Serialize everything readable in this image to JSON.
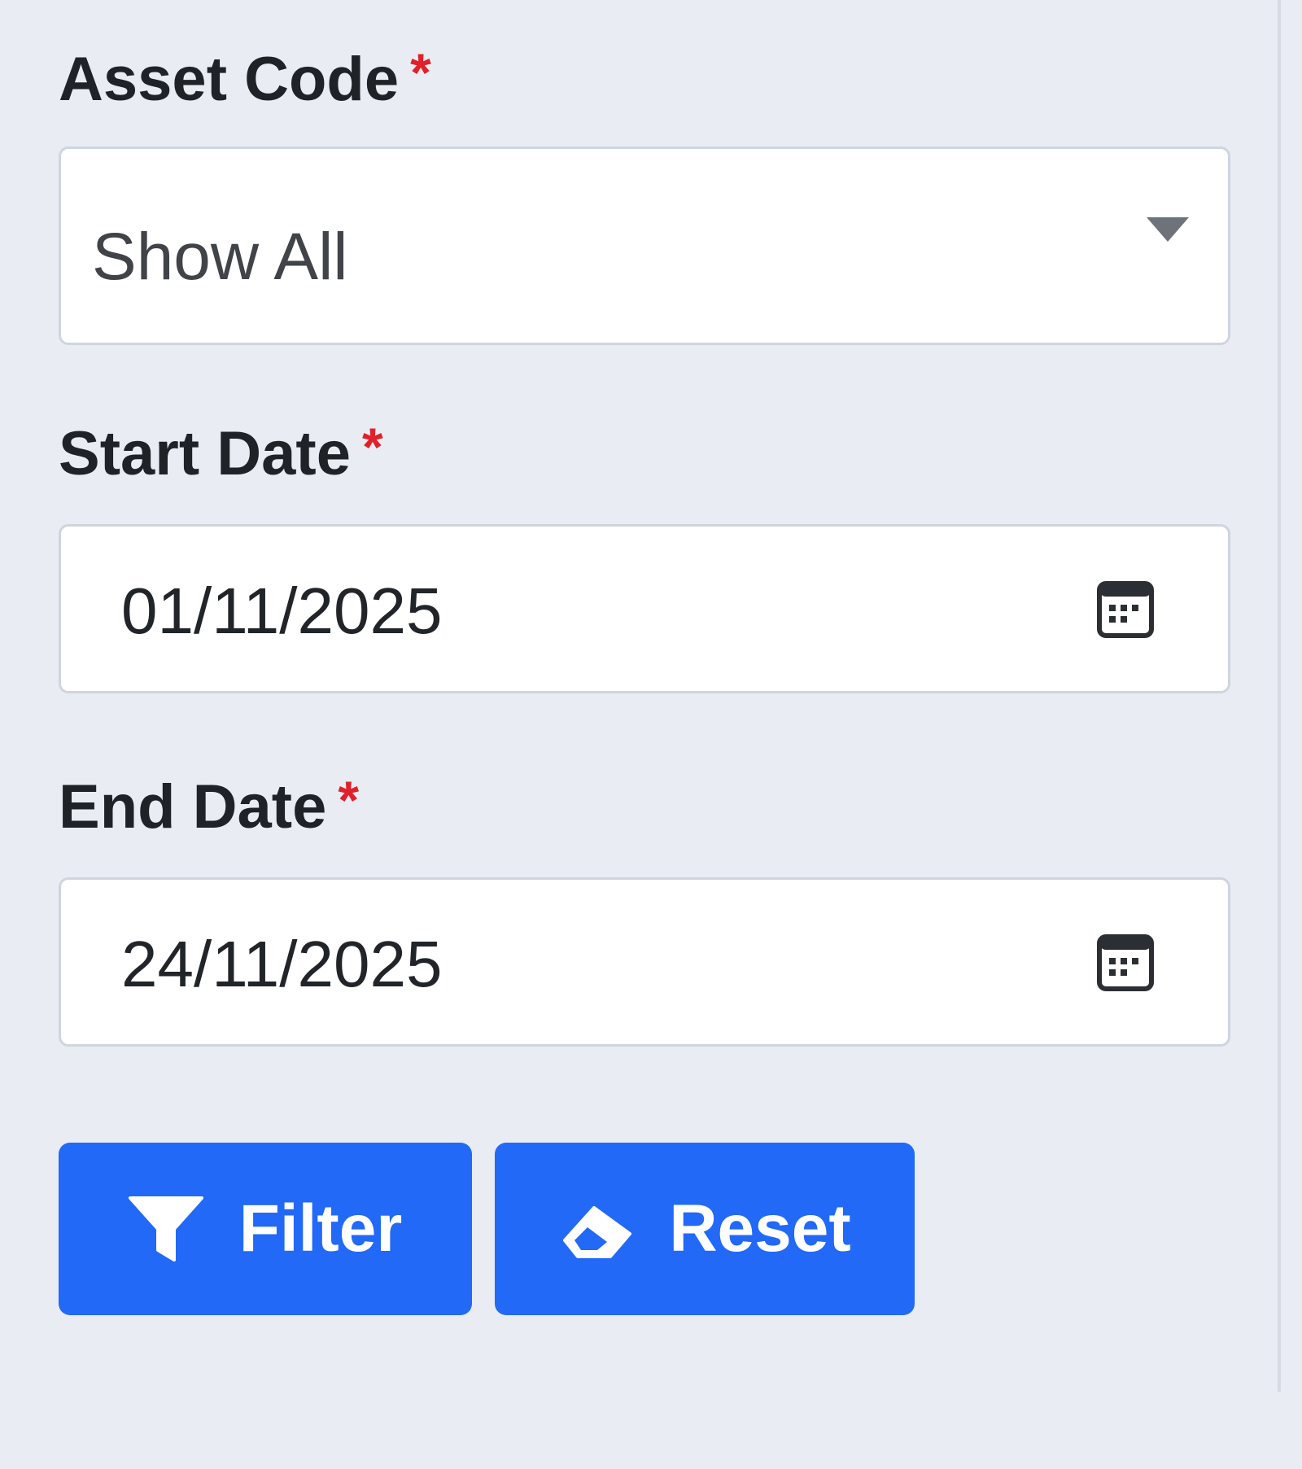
{
  "form": {
    "asset_code": {
      "label": "Asset Code",
      "required_mark": "*",
      "selected_value": "Show All",
      "icon": "chevron-down-icon"
    },
    "start_date": {
      "label": "Start Date",
      "required_mark": "*",
      "value": "01/11/2025",
      "icon": "calendar-icon"
    },
    "end_date": {
      "label": "End Date",
      "required_mark": "*",
      "value": "24/11/2025",
      "icon": "calendar-icon"
    }
  },
  "actions": {
    "filter_label": "Filter",
    "filter_icon": "filter-icon",
    "reset_label": "Reset",
    "reset_icon": "eraser-icon"
  },
  "colors": {
    "background": "#e9ecf3",
    "primary_button": "#2269f7",
    "required_mark": "#e0202a"
  }
}
